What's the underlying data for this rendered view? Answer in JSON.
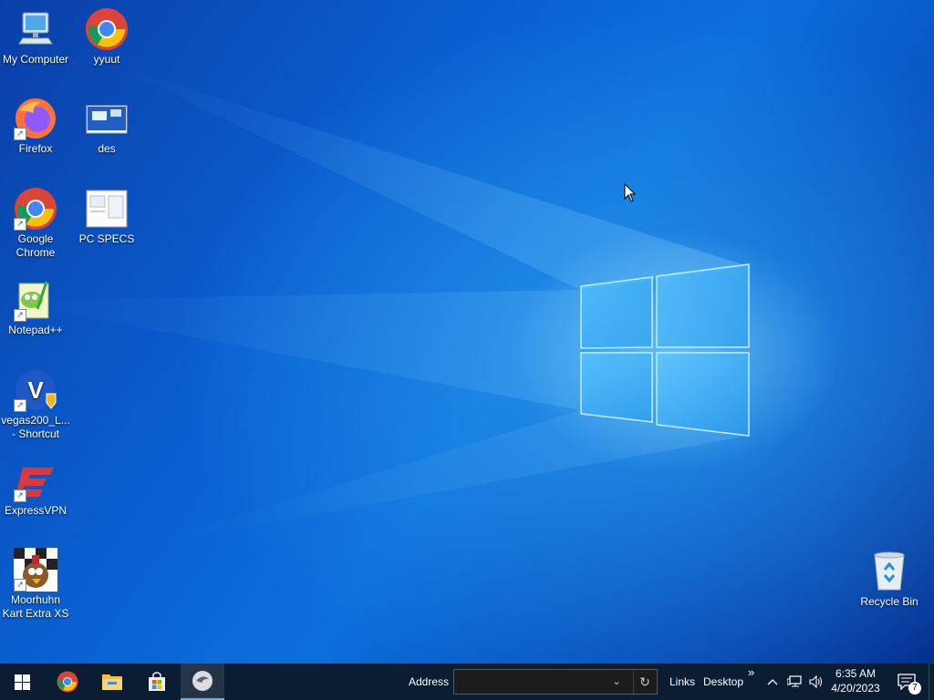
{
  "desktop": {
    "icons": [
      {
        "label": "My Computer"
      },
      {
        "label": "yyuut"
      },
      {
        "label": "Firefox"
      },
      {
        "label": "des"
      },
      {
        "label": "Google Chrome"
      },
      {
        "label": "PC SPECS"
      },
      {
        "label": "Notepad++"
      },
      {
        "label": "vegas200_L... - Shortcut"
      },
      {
        "label": "ExpressVPN"
      },
      {
        "label": "Moorhuhn Kart Extra XS"
      },
      {
        "label": "Recycle Bin"
      }
    ]
  },
  "taskbar": {
    "start_icon": "windows-start-icon",
    "pinned": [
      "chrome-icon",
      "file-explorer-icon",
      "microsoft-store-icon",
      "app-icon"
    ],
    "address_label": "Address",
    "address_value": "",
    "links_label": "Links",
    "desktop_label": "Desktop",
    "overflow_label": "»",
    "time": "6:35 AM",
    "date": "4/20/2023",
    "notification_count": "7"
  },
  "colors": {
    "taskbar_bg": "#0b1d33",
    "desktop_blue": "#0b6fdc"
  }
}
